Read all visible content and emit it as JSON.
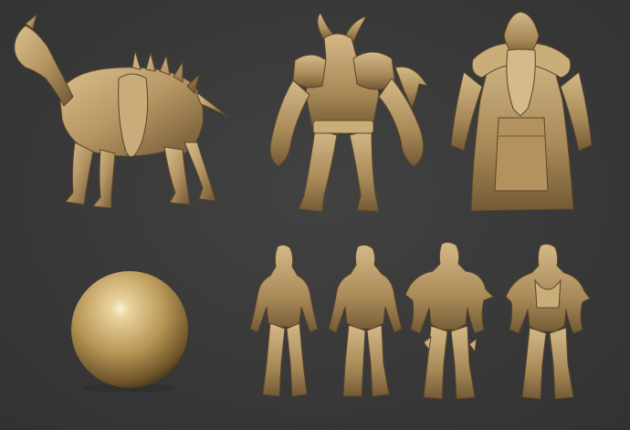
{
  "scene": {
    "background": "#3a3a3a",
    "material_base": "#b89a68",
    "material_shadow": "#6e5633",
    "material_highlight": "#e6d4a8",
    "models": [
      {
        "name": "undead-horse-sculpt"
      },
      {
        "name": "horned-demon-brute-sculpt"
      },
      {
        "name": "robed-bearded-elder-sculpt"
      },
      {
        "name": "material-preview-sphere"
      },
      {
        "name": "hooded-warrior-front-bare"
      },
      {
        "name": "hooded-warrior-back-bare"
      },
      {
        "name": "hooded-warrior-front-armored"
      },
      {
        "name": "hooded-warrior-back-armored"
      }
    ]
  }
}
